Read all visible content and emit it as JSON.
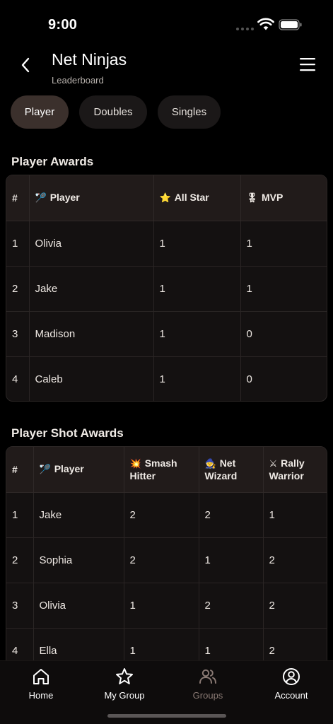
{
  "status": {
    "time": "9:00"
  },
  "header": {
    "title": "Net Ninjas",
    "subtitle": "Leaderboard"
  },
  "tabs": [
    {
      "label": "Player",
      "active": true
    },
    {
      "label": "Doubles",
      "active": false
    },
    {
      "label": "Singles",
      "active": false
    }
  ],
  "player_awards": {
    "title": "Player Awards",
    "columns": [
      {
        "emoji": "🏸",
        "label": "#"
      },
      {
        "emoji": "🏸",
        "label": "Player"
      },
      {
        "emoji": "⭐",
        "label": "All Star"
      },
      {
        "emoji": "🎖",
        "label": "MVP"
      }
    ],
    "rows": [
      [
        "1",
        "Olivia",
        "1",
        "1"
      ],
      [
        "2",
        "Jake",
        "1",
        "1"
      ],
      [
        "3",
        "Madison",
        "1",
        "0"
      ],
      [
        "4",
        "Caleb",
        "1",
        "0"
      ]
    ]
  },
  "shot_awards": {
    "title": "Player Shot Awards",
    "columns": [
      {
        "emoji": "",
        "label": "#"
      },
      {
        "emoji": "🏸",
        "label": "Player"
      },
      {
        "emoji": "💥",
        "label": "Smash Hitter"
      },
      {
        "emoji": "🧙",
        "label": "Net Wizard"
      },
      {
        "emoji": "⚔",
        "label": "Rally Warrior"
      }
    ],
    "rows": [
      [
        "1",
        "Jake",
        "2",
        "2",
        "1"
      ],
      [
        "2",
        "Sophia",
        "2",
        "1",
        "2"
      ],
      [
        "3",
        "Olivia",
        "1",
        "2",
        "2"
      ],
      [
        "4",
        "Ella",
        "1",
        "1",
        "2"
      ]
    ]
  },
  "nav": {
    "home": "Home",
    "my_group": "My Group",
    "groups": "Groups",
    "account": "Account",
    "active": "groups"
  },
  "colors": {
    "background": "#000000",
    "tab_active": "#3b302c",
    "tab_inactive": "#1b1818",
    "header_cell": "#211b1a",
    "nav_active": "#8a7a74"
  }
}
